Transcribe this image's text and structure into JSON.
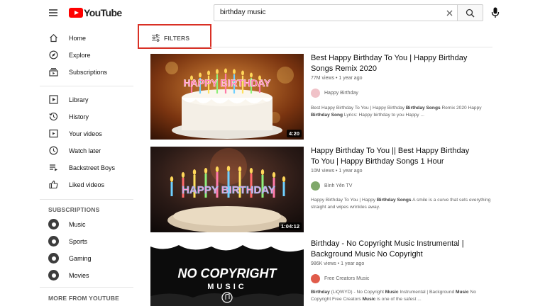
{
  "header": {
    "logo_text": "YouTube",
    "search_value": "birthday music"
  },
  "sidebar": {
    "main_items": [
      {
        "label": "Home",
        "icon": "home-icon"
      },
      {
        "label": "Explore",
        "icon": "compass-icon"
      },
      {
        "label": "Subscriptions",
        "icon": "subscriptions-icon"
      }
    ],
    "library_items": [
      {
        "label": "Library",
        "icon": "library-icon"
      },
      {
        "label": "History",
        "icon": "history-icon"
      },
      {
        "label": "Your videos",
        "icon": "your-videos-icon"
      },
      {
        "label": "Watch later",
        "icon": "clock-icon"
      },
      {
        "label": "Backstreet Boys",
        "icon": "playlist-icon"
      },
      {
        "label": "Liked videos",
        "icon": "thumbs-up-icon"
      }
    ],
    "subscriptions_heading": "SUBSCRIPTIONS",
    "subscriptions": [
      {
        "label": "Music"
      },
      {
        "label": "Sports"
      },
      {
        "label": "Gaming"
      },
      {
        "label": "Movies"
      }
    ],
    "more_heading": "MORE FROM YOUTUBE"
  },
  "filters": {
    "label": "FILTERS",
    "highlight_color": "#d93025"
  },
  "results": [
    {
      "title": "Best Happy Birthday To You | Happy Birthday Songs Remix 2020",
      "meta": "77M views • 1 year ago",
      "channel": "Happy Birthday",
      "desc_parts": [
        {
          "t": "Best Happy Birthday To You | Happy Birthday "
        },
        {
          "t": "Birthday Songs",
          "b": true
        },
        {
          "t": " Remix 2020 Happy "
        },
        {
          "t": "Birthday",
          "b": true
        },
        {
          "t": " "
        },
        {
          "t": "Song",
          "b": true
        },
        {
          "t": " Lyrics: Happy birthday to you Happy ..."
        }
      ],
      "duration": "4:20",
      "thumb_text": "HAPPY BIRTHDAY"
    },
    {
      "title": "Happy Birthday To You || Best Happy Birthday To You | Happy Birthday Songs 1 Hour",
      "meta": "10M views • 1 year ago",
      "channel": "Bình Yên TV",
      "desc_parts": [
        {
          "t": "Happy Birthday To You | Happy "
        },
        {
          "t": "Birthday Songs",
          "b": true
        },
        {
          "t": " A smile is a curve that sets everything straight and wipes wrinkles away."
        }
      ],
      "duration": "1:04:12",
      "thumb_text": "HAPPY BIRTHDAY"
    },
    {
      "title": "Birthday - No Copyright Music Instrumental | Background Music No Copyright",
      "meta": "986K views • 1 year ago",
      "channel": "Free Creators Music",
      "desc_parts": [
        {
          "t": "Birthday",
          "b": true
        },
        {
          "t": " (LiQWYD) - No Copyright "
        },
        {
          "t": "Music",
          "b": true
        },
        {
          "t": " Instrumental | Background "
        },
        {
          "t": "Music",
          "b": true
        },
        {
          "t": " No Copyright Free Creators "
        },
        {
          "t": "Music",
          "b": true
        },
        {
          "t": " is one of the safest ..."
        }
      ],
      "duration": "",
      "thumb_text_line1": "NO COPYRIGHT",
      "thumb_text_line2": "MUSIC"
    }
  ]
}
